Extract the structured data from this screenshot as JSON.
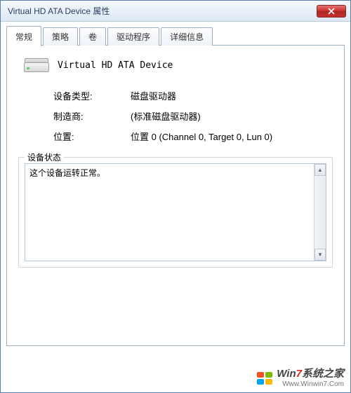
{
  "window": {
    "title": "Virtual HD ATA Device 属性"
  },
  "tabs": {
    "items": [
      {
        "label": "常规",
        "active": true
      },
      {
        "label": "策略",
        "active": false
      },
      {
        "label": "卷",
        "active": false
      },
      {
        "label": "驱动程序",
        "active": false
      },
      {
        "label": "详细信息",
        "active": false
      }
    ]
  },
  "device": {
    "name": "Virtual HD ATA Device",
    "type_label": "设备类型:",
    "type_value": "磁盘驱动器",
    "manufacturer_label": "制造商:",
    "manufacturer_value": "(标准磁盘驱动器)",
    "location_label": "位置:",
    "location_value": "位置 0 (Channel 0, Target 0, Lun 0)"
  },
  "status": {
    "legend": "设备状态",
    "text": "这个设备运转正常。"
  },
  "watermark": {
    "line1_prefix": "Win",
    "line1_highlight": "7",
    "line1_suffix": "系统之家",
    "line2": "Www.Winwin7.Com"
  }
}
